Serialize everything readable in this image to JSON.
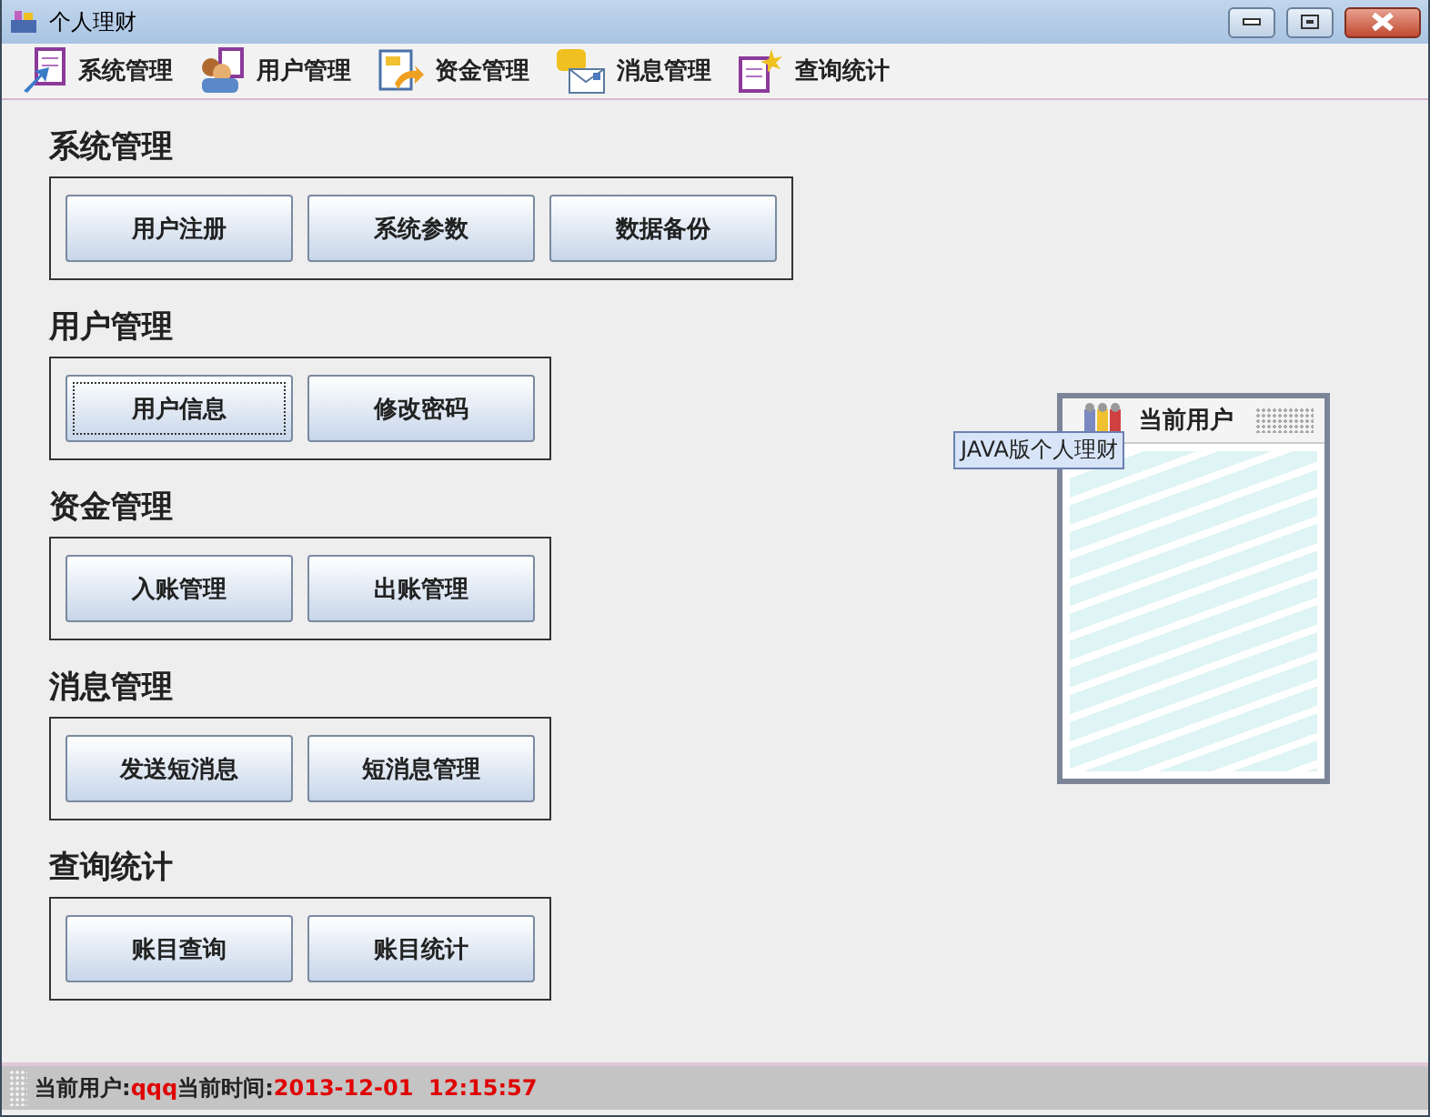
{
  "window": {
    "title": "个人理财"
  },
  "toolbar": [
    {
      "label": "系统管理",
      "kind": "system"
    },
    {
      "label": "用户管理",
      "kind": "users"
    },
    {
      "label": "资金管理",
      "kind": "money"
    },
    {
      "label": "消息管理",
      "kind": "message"
    },
    {
      "label": "查询统计",
      "kind": "query"
    }
  ],
  "sections": [
    {
      "title": "系统管理",
      "buttons": [
        {
          "label": "用户注册",
          "focused": false
        },
        {
          "label": "系统参数",
          "focused": false
        },
        {
          "label": "数据备份",
          "focused": false
        }
      ]
    },
    {
      "title": "用户管理",
      "buttons": [
        {
          "label": "用户信息",
          "focused": true
        },
        {
          "label": "修改密码",
          "focused": false
        }
      ]
    },
    {
      "title": "资金管理",
      "buttons": [
        {
          "label": "入账管理",
          "focused": false
        },
        {
          "label": "出账管理",
          "focused": false
        }
      ]
    },
    {
      "title": "消息管理",
      "buttons": [
        {
          "label": "发送短消息",
          "focused": false
        },
        {
          "label": "短消息管理",
          "focused": false
        }
      ]
    },
    {
      "title": "查询统计",
      "buttons": [
        {
          "label": "账目查询",
          "focused": false
        },
        {
          "label": "账目统计",
          "focused": false
        }
      ]
    }
  ],
  "user_card": {
    "title": "当前用户",
    "tooltip": "JAVA版个人理财"
  },
  "status_bar": {
    "user_label": "当前用户:",
    "user": "qqq",
    "time_label": "当前时间:",
    "time": "2013-12-01  12:15:57"
  }
}
